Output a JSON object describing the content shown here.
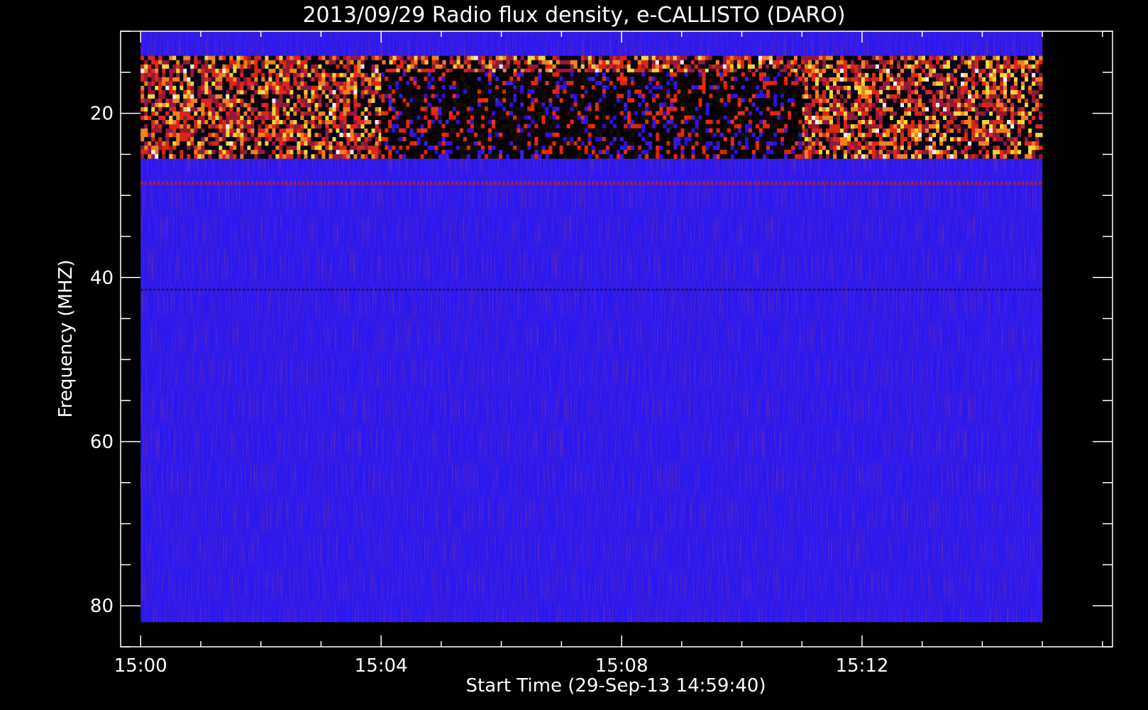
{
  "chart_data": {
    "type": "heatmap",
    "title": "2013/09/29  Radio flux density, e-CALLISTO (DARO)",
    "xlabel": "Start Time (29-Sep-13 14:59:40)",
    "ylabel": "Frequency (MHZ)",
    "x_axis": {
      "unit": "time",
      "range": [
        "14:59:40",
        "15:16:10"
      ],
      "data_range": [
        "15:00:00",
        "15:15:00"
      ],
      "major_ticks": [
        "15:00",
        "15:04",
        "15:08",
        "15:12"
      ],
      "minor_tick_step_minutes": 1
    },
    "y_axis": {
      "unit": "MHz",
      "inverted": true,
      "range": [
        10,
        85
      ],
      "data_range": [
        10,
        82
      ],
      "major_ticks": [
        20,
        40,
        60,
        80
      ],
      "minor_tick_step": 5
    },
    "colormap": [
      "#000000",
      "#2a10f0",
      "#9a1a2a",
      "#e82808",
      "#ff8a10",
      "#ffe830",
      "#ffffff"
    ],
    "background_color": "#2a18f2",
    "features": [
      {
        "name": "strong RFI band",
        "freq_range_mhz": [
          13,
          25.5
        ],
        "time_range": [
          "15:00",
          "15:15"
        ],
        "level": "high"
      },
      {
        "name": "dark (low-signal) band",
        "freq_range_mhz": [
          15,
          25.5
        ],
        "time_range": [
          "15:04",
          "15:11"
        ],
        "level": "low"
      },
      {
        "name": "faint line",
        "freq_mhz": 41.5,
        "time_range": [
          "15:00",
          "15:15"
        ],
        "level": "low"
      },
      {
        "name": "faint line",
        "freq_mhz": 28.5,
        "time_range": [
          "15:00",
          "15:15"
        ],
        "level": "medium"
      }
    ]
  }
}
